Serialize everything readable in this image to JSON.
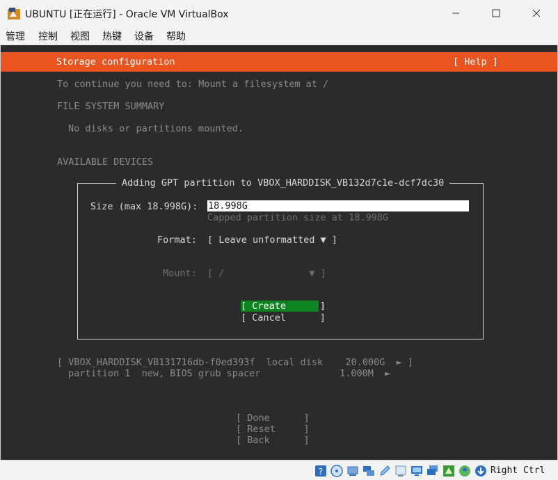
{
  "window": {
    "title": "UBUNTU [正在运行] - Oracle VM VirtualBox",
    "minimize_glyph": "—",
    "maximize_glyph": "☐",
    "close_glyph": "✕"
  },
  "menu": [
    "管理",
    "控制",
    "视图",
    "热键",
    "设备",
    "帮助"
  ],
  "installer": {
    "header_title": "Storage configuration",
    "help_label": "[ Help ]",
    "instruction": "To continue you need to: Mount a filesystem at /",
    "fs_summary_heading": "FILE SYSTEM SUMMARY",
    "fs_summary_empty": "No disks or partitions mounted.",
    "available_devices_heading": "AVAILABLE DEVICES",
    "dialog": {
      "title": "Adding GPT partition to VBOX_HARDDISK_VB132d7c1e-dcf7dc30",
      "size_label": "Size (max 18.998G):",
      "size_value": "18.998G",
      "size_hint": "Capped partition size at 18.998G",
      "format_label": "Format:",
      "format_value": "[ Leave unformatted ▼ ]",
      "mount_label": "Mount:",
      "mount_value": "[ /               ▼ ]",
      "create_label": "[ Create      ]",
      "cancel_label": "[ Cancel      ]"
    },
    "device_row": "[ VBOX_HARDDISK_VB131716db-f0ed393f  local disk    20.000G  ► ]",
    "partition_row": "partition 1  new, BIOS grub spacer              1.000M  ►",
    "done_label": "[ Done      ]",
    "reset_label": "[ Reset     ]",
    "back_label": "[ Back      ]"
  },
  "statusbar": {
    "icons": [
      "optical-drive-icon",
      "cd-icon",
      "usb-icon",
      "network-icon",
      "pencil-icon",
      "shared-folders-icon",
      "display-icon",
      "monitor-icon",
      "network-adapter-icon",
      "cpu-icon",
      "globe-icon",
      "download-arrow-icon"
    ],
    "host_key": "Right Ctrl"
  }
}
